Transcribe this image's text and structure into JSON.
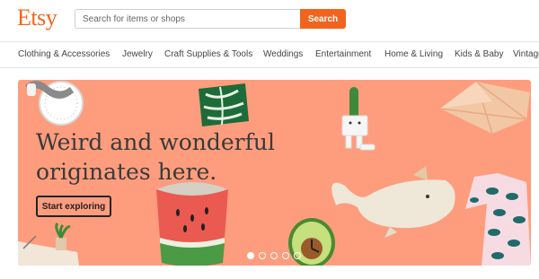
{
  "header": {
    "logo": "Etsy",
    "search": {
      "placeholder": "Search for items or shops",
      "value": ""
    },
    "search_button": "Search"
  },
  "nav": {
    "items": [
      "Clothing & Accessories",
      "Jewelry",
      "Craft Supplies & Tools",
      "Weddings",
      "Entertainment",
      "Home & Living",
      "Kids & Baby",
      "Vintage"
    ]
  },
  "hero": {
    "headline_line1": "Weird and wonderful",
    "headline_line2": "originates here.",
    "cta": "Start exploring",
    "background_color": "#fd9d7e",
    "slides": 5,
    "active_slide": 1,
    "images": [
      "sloth-clock",
      "palm-leaf-pillow",
      "cactus-planter",
      "origami-box",
      "watermelon-cup",
      "whale-plush",
      "avocado-clock",
      "leaf-print-shirt",
      "desk-plant"
    ]
  },
  "colors": {
    "brand": "#f1641e",
    "text": "#222222"
  }
}
